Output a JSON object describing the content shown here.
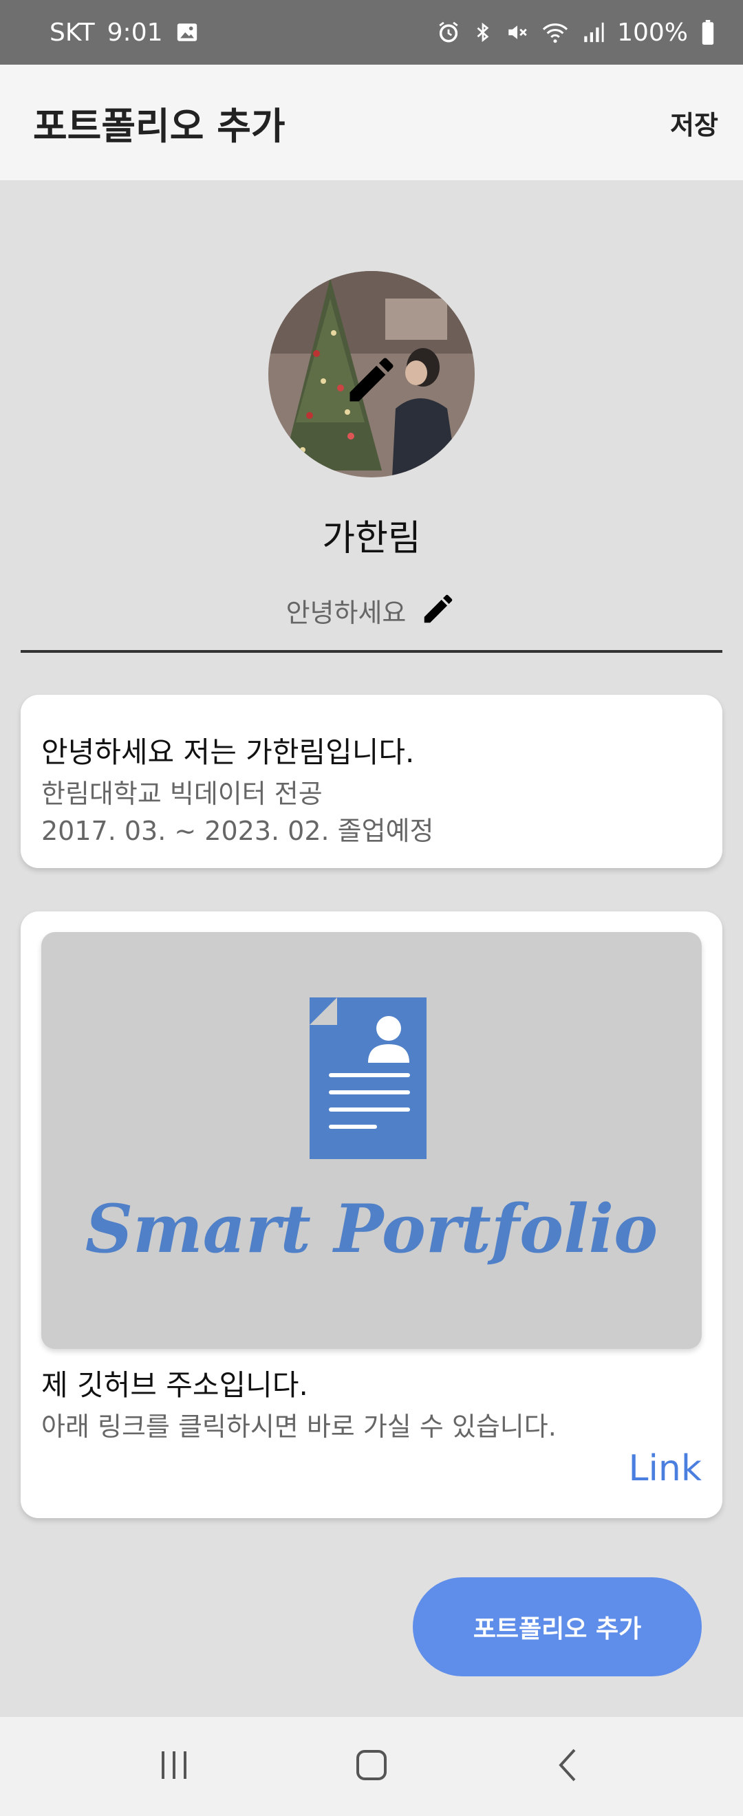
{
  "status_bar": {
    "carrier": "SKT",
    "time": "9:01",
    "battery": "100%",
    "icons": [
      "gallery-icon",
      "alarm-icon",
      "bluetooth-icon",
      "mute-icon",
      "wifi-icon",
      "signal-icon",
      "battery-icon"
    ]
  },
  "app_bar": {
    "title": "포트폴리오 추가",
    "save_label": "저장"
  },
  "profile": {
    "name": "가한림",
    "status_message": "안녕하세요"
  },
  "intro_card": {
    "title": "안녕하세요 저는 가한림입니다.",
    "line1": "한림대학교 빅데이터 전공",
    "line2": "2017. 03. ~ 2023. 02. 졸업예정"
  },
  "portfolio_card": {
    "cover_text": "Smart Portfolio",
    "title": "제 깃허브 주소입니다.",
    "description": "아래 링크를 클릭하시면 바로 가실 수 있습니다.",
    "link_label": "Link"
  },
  "fab": {
    "label": "포트폴리오 추가"
  },
  "colors": {
    "accent": "#5f8dea",
    "link": "#4a7fe0",
    "logo_blue": "#5080c8",
    "background": "#e0e0e0"
  }
}
